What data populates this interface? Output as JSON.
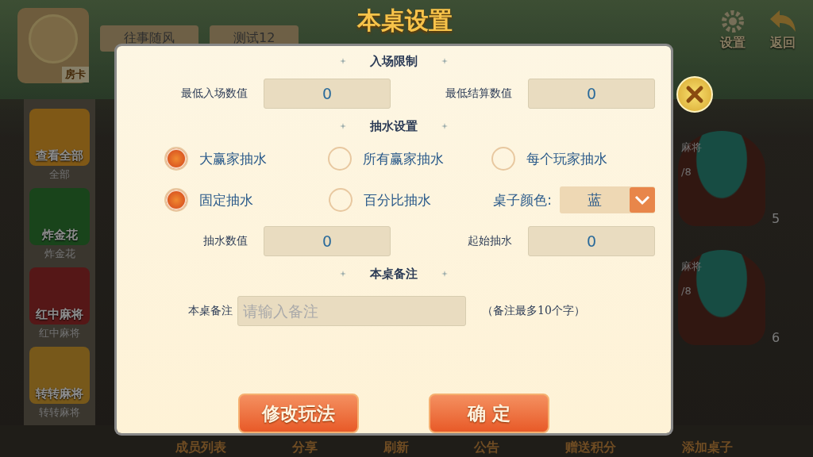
{
  "top_bar": {
    "player_name": "往事随风",
    "player_id": "测试12",
    "room_card": "房卡",
    "buttons": [
      {
        "label": "设置",
        "kind": "gear"
      },
      {
        "label": "返回",
        "kind": "back"
      }
    ]
  },
  "sidebar": {
    "items": [
      {
        "icon_text": "查看全部",
        "label": "全部"
      },
      {
        "icon_text": "炸金花",
        "label": "炸金花"
      },
      {
        "icon_text": "红中麻将",
        "label": "红中麻将"
      },
      {
        "icon_text": "转转麻将",
        "label": "转转麻将"
      }
    ]
  },
  "tables": [
    {
      "game": "麻将",
      "seats": "/8",
      "number": "5"
    },
    {
      "game": "麻将",
      "seats": "/8",
      "number": "6"
    }
  ],
  "bottom_bar": {
    "items": [
      "成员列表",
      "分享",
      "刷新",
      "公告",
      "赠送积分",
      "添加桌子"
    ]
  },
  "dialog": {
    "title": "本桌设置",
    "entry_section": {
      "heading": "入场限制",
      "fields": [
        {
          "label": "最低入场数值",
          "value": "0"
        },
        {
          "label": "最低结算数值",
          "value": "0"
        }
      ]
    },
    "fee_section": {
      "heading": "抽水设置",
      "fee_target": [
        {
          "label": "大赢家抽水",
          "selected": true
        },
        {
          "label": "所有赢家抽水",
          "selected": false
        },
        {
          "label": "每个玩家抽水",
          "selected": false
        }
      ],
      "fee_type": [
        {
          "label": "固定抽水",
          "selected": true
        },
        {
          "label": "百分比抽水",
          "selected": false
        }
      ],
      "table_color": {
        "label": "桌子颜色:",
        "value": "蓝"
      },
      "fields": [
        {
          "label": "抽水数值",
          "value": "0"
        },
        {
          "label": "起始抽水",
          "value": "0"
        }
      ]
    },
    "note_section": {
      "heading": "本桌备注",
      "label": "本桌备注",
      "placeholder": "请输入备注",
      "hint": "（备注最多10个字）"
    },
    "buttons": [
      "修改玩法",
      "确 定"
    ]
  }
}
